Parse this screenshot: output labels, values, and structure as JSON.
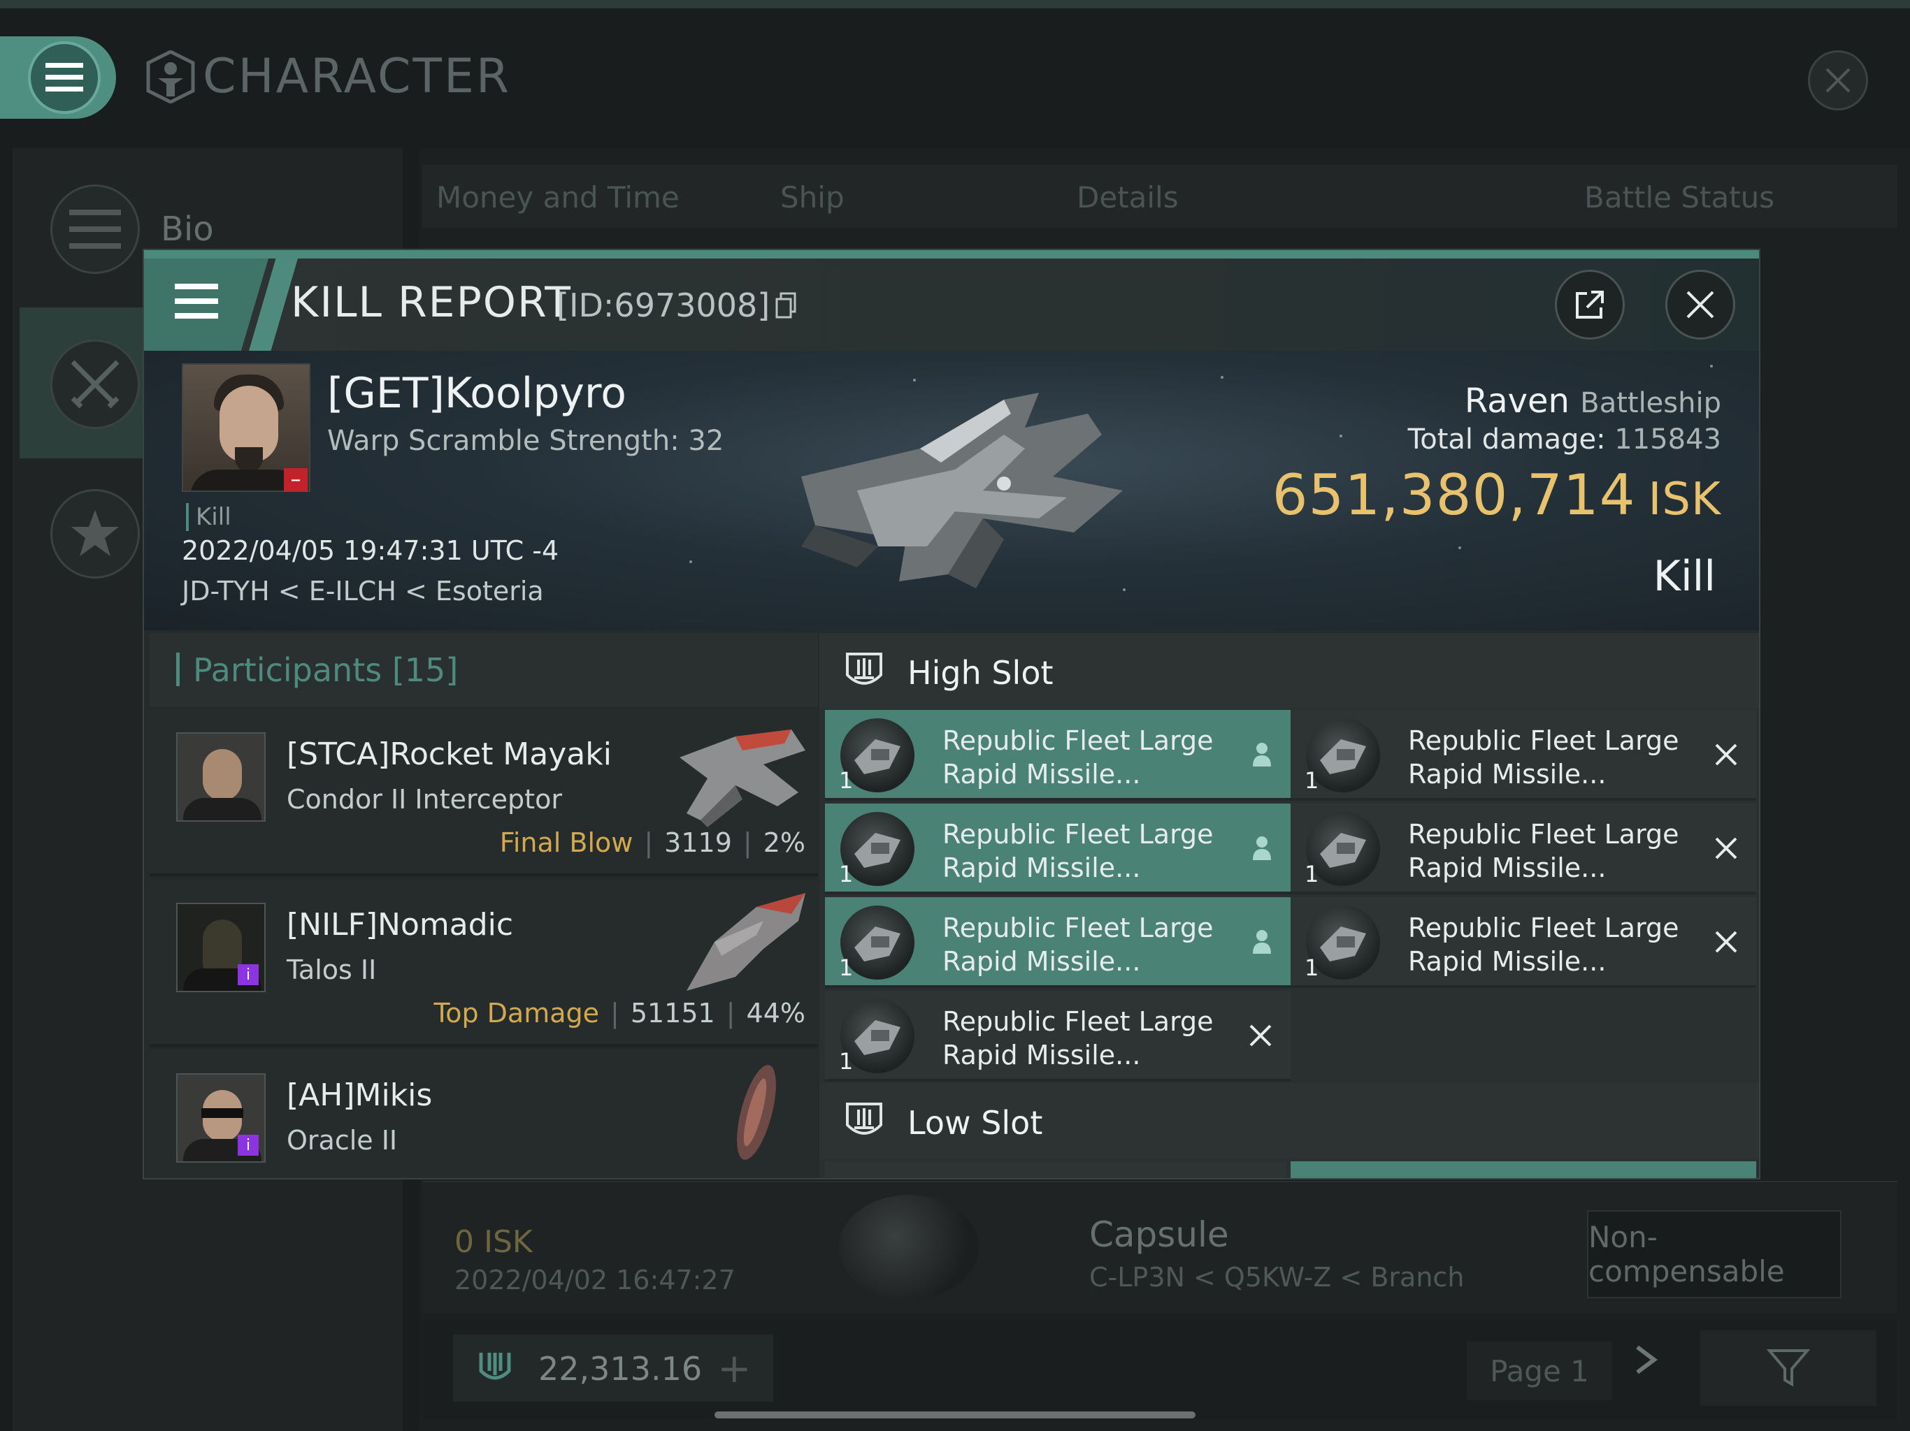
{
  "background": {
    "title": "CHARACTER",
    "sidebar": {
      "bio_label": "Bio"
    },
    "tabs": [
      "Money and Time",
      "Ship",
      "Details",
      "Battle Status"
    ],
    "row": {
      "isk": "0  ISK",
      "date": "2022/04/02  16:47:27",
      "ship": "Capsule",
      "location": "C-LP3N < Q5KW-Z < Branch",
      "badge": "Non-compensable"
    },
    "footer": {
      "wallet_value": "22,313.16",
      "page": "Page 1"
    }
  },
  "kill_report": {
    "title": "KILL REPORT",
    "id_label": "[ID:6973008]",
    "victim": {
      "name": "[GET]Koolpyro",
      "warp_scramble": "Warp Scramble Strength: 32",
      "type": "Kill",
      "datetime": "2022/04/05 19:47:31 UTC -4",
      "location": "JD-TYH < E-ILCH < Esoteria"
    },
    "ship": {
      "name": "Raven",
      "class": "Battleship",
      "total_damage_label": "Total damage:",
      "total_damage": "115843",
      "isk_value": "651,380,714",
      "isk_unit": "ISK",
      "result": "Kill"
    },
    "participants": {
      "title": "Participants",
      "count": "[15]",
      "items": [
        {
          "name": "[STCA]Rocket Mayaki",
          "ship": "Condor II Interceptor",
          "tag": "Final Blow",
          "damage": "3119",
          "percent": "2%"
        },
        {
          "name": "[NILF]Nomadic",
          "ship": "Talos II",
          "tag": "Top Damage",
          "damage": "51151",
          "percent": "44%"
        },
        {
          "name": "[AH]Mikis",
          "ship": "Oracle II",
          "tag": "",
          "damage": "",
          "percent": ""
        }
      ]
    },
    "fitting": {
      "high_slot_title": "High Slot",
      "low_slot_title": "Low Slot",
      "module_name_line1": "Republic Fleet Large",
      "module_name_line2": "Rapid Missile...",
      "quantity": "1"
    },
    "colors": {
      "accent": "#4e8a7d",
      "fitted_module": "#4a8275",
      "isk_gold": "#e8c26d",
      "victim_badge": "#c2232a",
      "participant_badge": "#8b34e0"
    }
  }
}
